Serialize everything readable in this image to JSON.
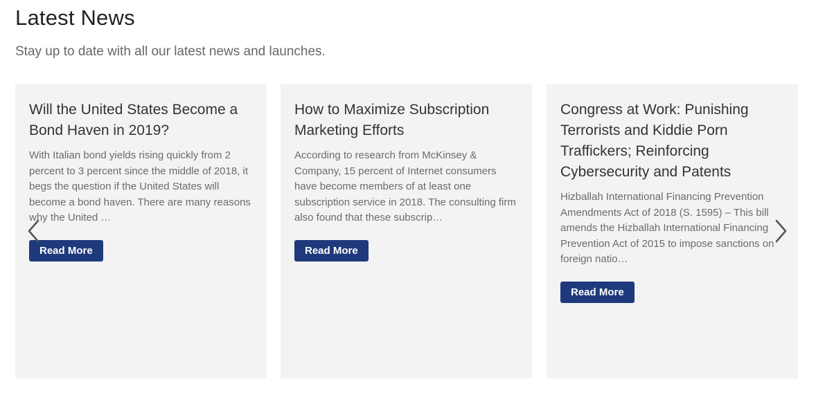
{
  "section": {
    "title": "Latest News",
    "subtitle": "Stay up to date with all our latest news and launches."
  },
  "carousel": {
    "prev_icon": "chevron-left-icon",
    "next_icon": "chevron-right-icon",
    "cards": [
      {
        "title": "Will the United States Become a Bond Haven in 2019?",
        "excerpt": "With Italian bond yields rising quickly from 2 percent to 3 percent since the middle of 2018, it begs the question if the United States will become a bond haven. There are many reasons why the United …",
        "button_label": "Read More"
      },
      {
        "title": "How to Maximize Subscription Marketing Efforts",
        "excerpt": "According to research from McKinsey & Company, 15 percent of Internet consumers have become members of at least one subscription service in 2018. The consulting firm also found that these subscrip…",
        "button_label": "Read More"
      },
      {
        "title": "Congress at Work: Punishing Terrorists and Kiddie Porn Traffickers; Reinforcing Cybersecurity and Patents",
        "excerpt": "Hizballah International Financing Prevention Amendments Act of 2018 (S. 1595) – This bill amends the Hizballah International Financing Prevention Act of 2015 to impose sanctions on foreign natio…",
        "button_label": "Read More"
      }
    ]
  },
  "colors": {
    "card_background": "#f3f3f3",
    "button_background": "#1f3a7c",
    "button_text": "#ffffff"
  }
}
